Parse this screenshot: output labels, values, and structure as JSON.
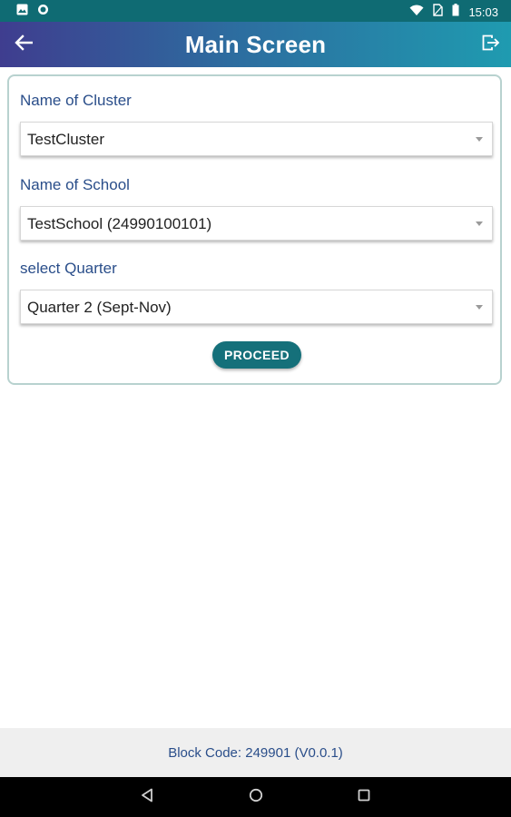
{
  "status_bar": {
    "time": "15:03",
    "icons": [
      "notification-image-icon",
      "circle-icon",
      "wifi-icon",
      "no-sim-icon",
      "battery-icon"
    ]
  },
  "app_bar": {
    "title": "Main Screen",
    "back_icon": "back-arrow-icon",
    "logout_icon": "logout-icon",
    "colors": {
      "gradient_start": "#3f3d8f",
      "gradient_end": "#1f9bb0"
    }
  },
  "form": {
    "cluster": {
      "label": "Name of Cluster",
      "value": "TestCluster"
    },
    "school": {
      "label": "Name of School",
      "value": "TestSchool (24990100101)"
    },
    "quarter": {
      "label": "select Quarter",
      "value": "Quarter 2 (Sept-Nov)"
    },
    "proceed_label": "PROCEED",
    "colors": {
      "label": "#2a4e8a",
      "button": "#15707a"
    }
  },
  "footer": {
    "text": "Block Code: 249901 (V0.0.1)"
  },
  "nav_bar": {
    "icons": [
      "nav-back-icon",
      "nav-home-icon",
      "nav-recents-icon"
    ]
  }
}
